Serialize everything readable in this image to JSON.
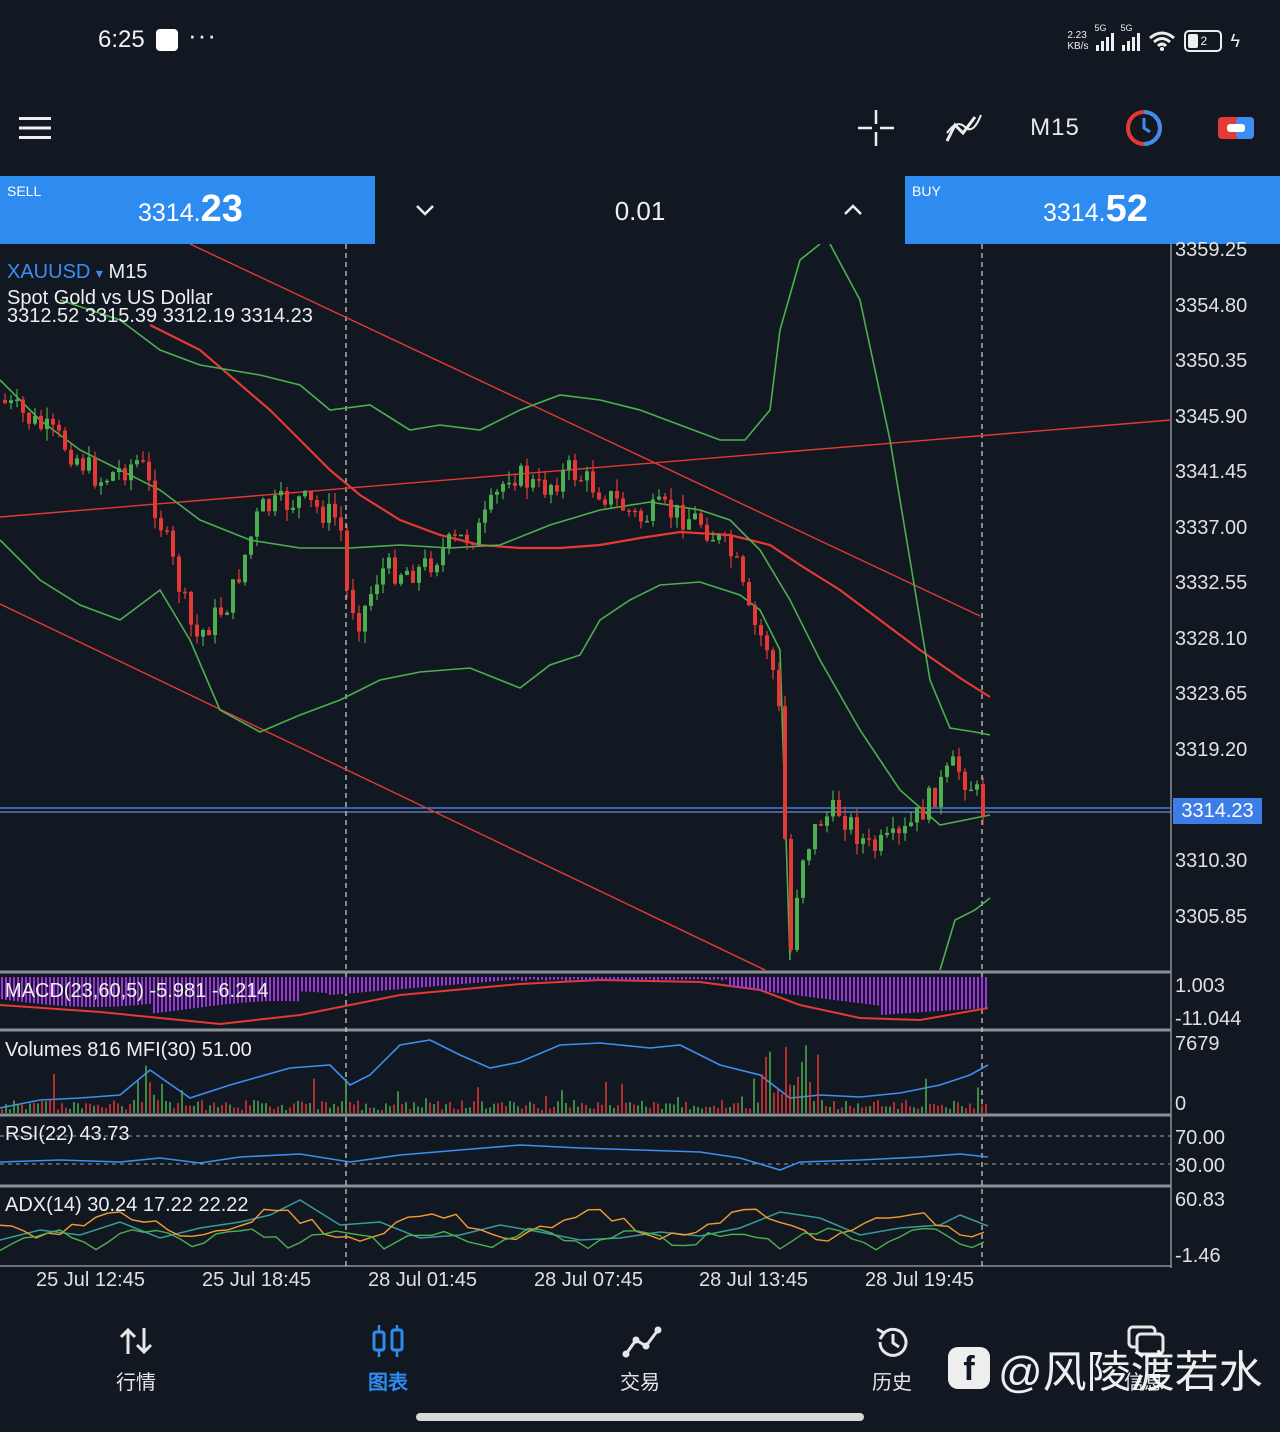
{
  "status": {
    "time": "6:25",
    "dots": "···",
    "speed_top": "2.23",
    "speed_bottom": "KB/s",
    "net1": "5G",
    "net2": "5G",
    "battery": "2"
  },
  "toolbar": {
    "timeframe": "M15"
  },
  "trade": {
    "sell_label": "SELL",
    "sell_price_small": "3314.",
    "sell_price_big": "23",
    "lot": "0.01",
    "buy_label": "BUY",
    "buy_price_small": "3314.",
    "buy_price_big": "52"
  },
  "chart": {
    "symbol": "XAUUSD",
    "symbol_arrow": "▾",
    "timeframe": "M15",
    "description": "Spot Gold vs US Dollar",
    "ohlc": "3312.52 3315.39 3312.19 3314.23",
    "current_price": "3314.23",
    "price_axis": [
      "3359.25",
      "3354.80",
      "3350.35",
      "3345.90",
      "3341.45",
      "3337.00",
      "3332.55",
      "3328.10",
      "3323.65",
      "3319.20",
      "3310.30",
      "3305.85"
    ],
    "time_axis": [
      "25 Jul 12:45",
      "25 Jul 18:45",
      "28 Jul 01:45",
      "28 Jul 07:45",
      "28 Jul 13:45",
      "28 Jul 19:45"
    ],
    "colors": {
      "bull": "#4caf50",
      "bear": "#e53935",
      "ma": "#e53935",
      "bands": "#4caf50",
      "trend": "#e53935",
      "price_line": "#3d7de8"
    }
  },
  "indicators": {
    "macd": {
      "label": "MACD(23,60,5) -5.981 -6.214",
      "axis_top": "1.003",
      "axis_bottom": "-11.044"
    },
    "volumes": {
      "label": "Volumes 816 MFI(30) 51.00",
      "axis_top": "7679",
      "axis_bottom": "0"
    },
    "rsi": {
      "label": "RSI(22) 43.73",
      "axis_top": "70.00",
      "axis_bottom": "30.00"
    },
    "adx": {
      "label": "ADX(14) 30.24 17.22 22.22",
      "axis_top": "60.83",
      "axis_bottom": "-1.46"
    }
  },
  "nav": {
    "quotes": "行情",
    "chart": "图表",
    "trade": "交易",
    "history": "历史",
    "messages": "信息"
  },
  "watermark": {
    "logo": "f",
    "text": "@风陵渡若水"
  }
}
